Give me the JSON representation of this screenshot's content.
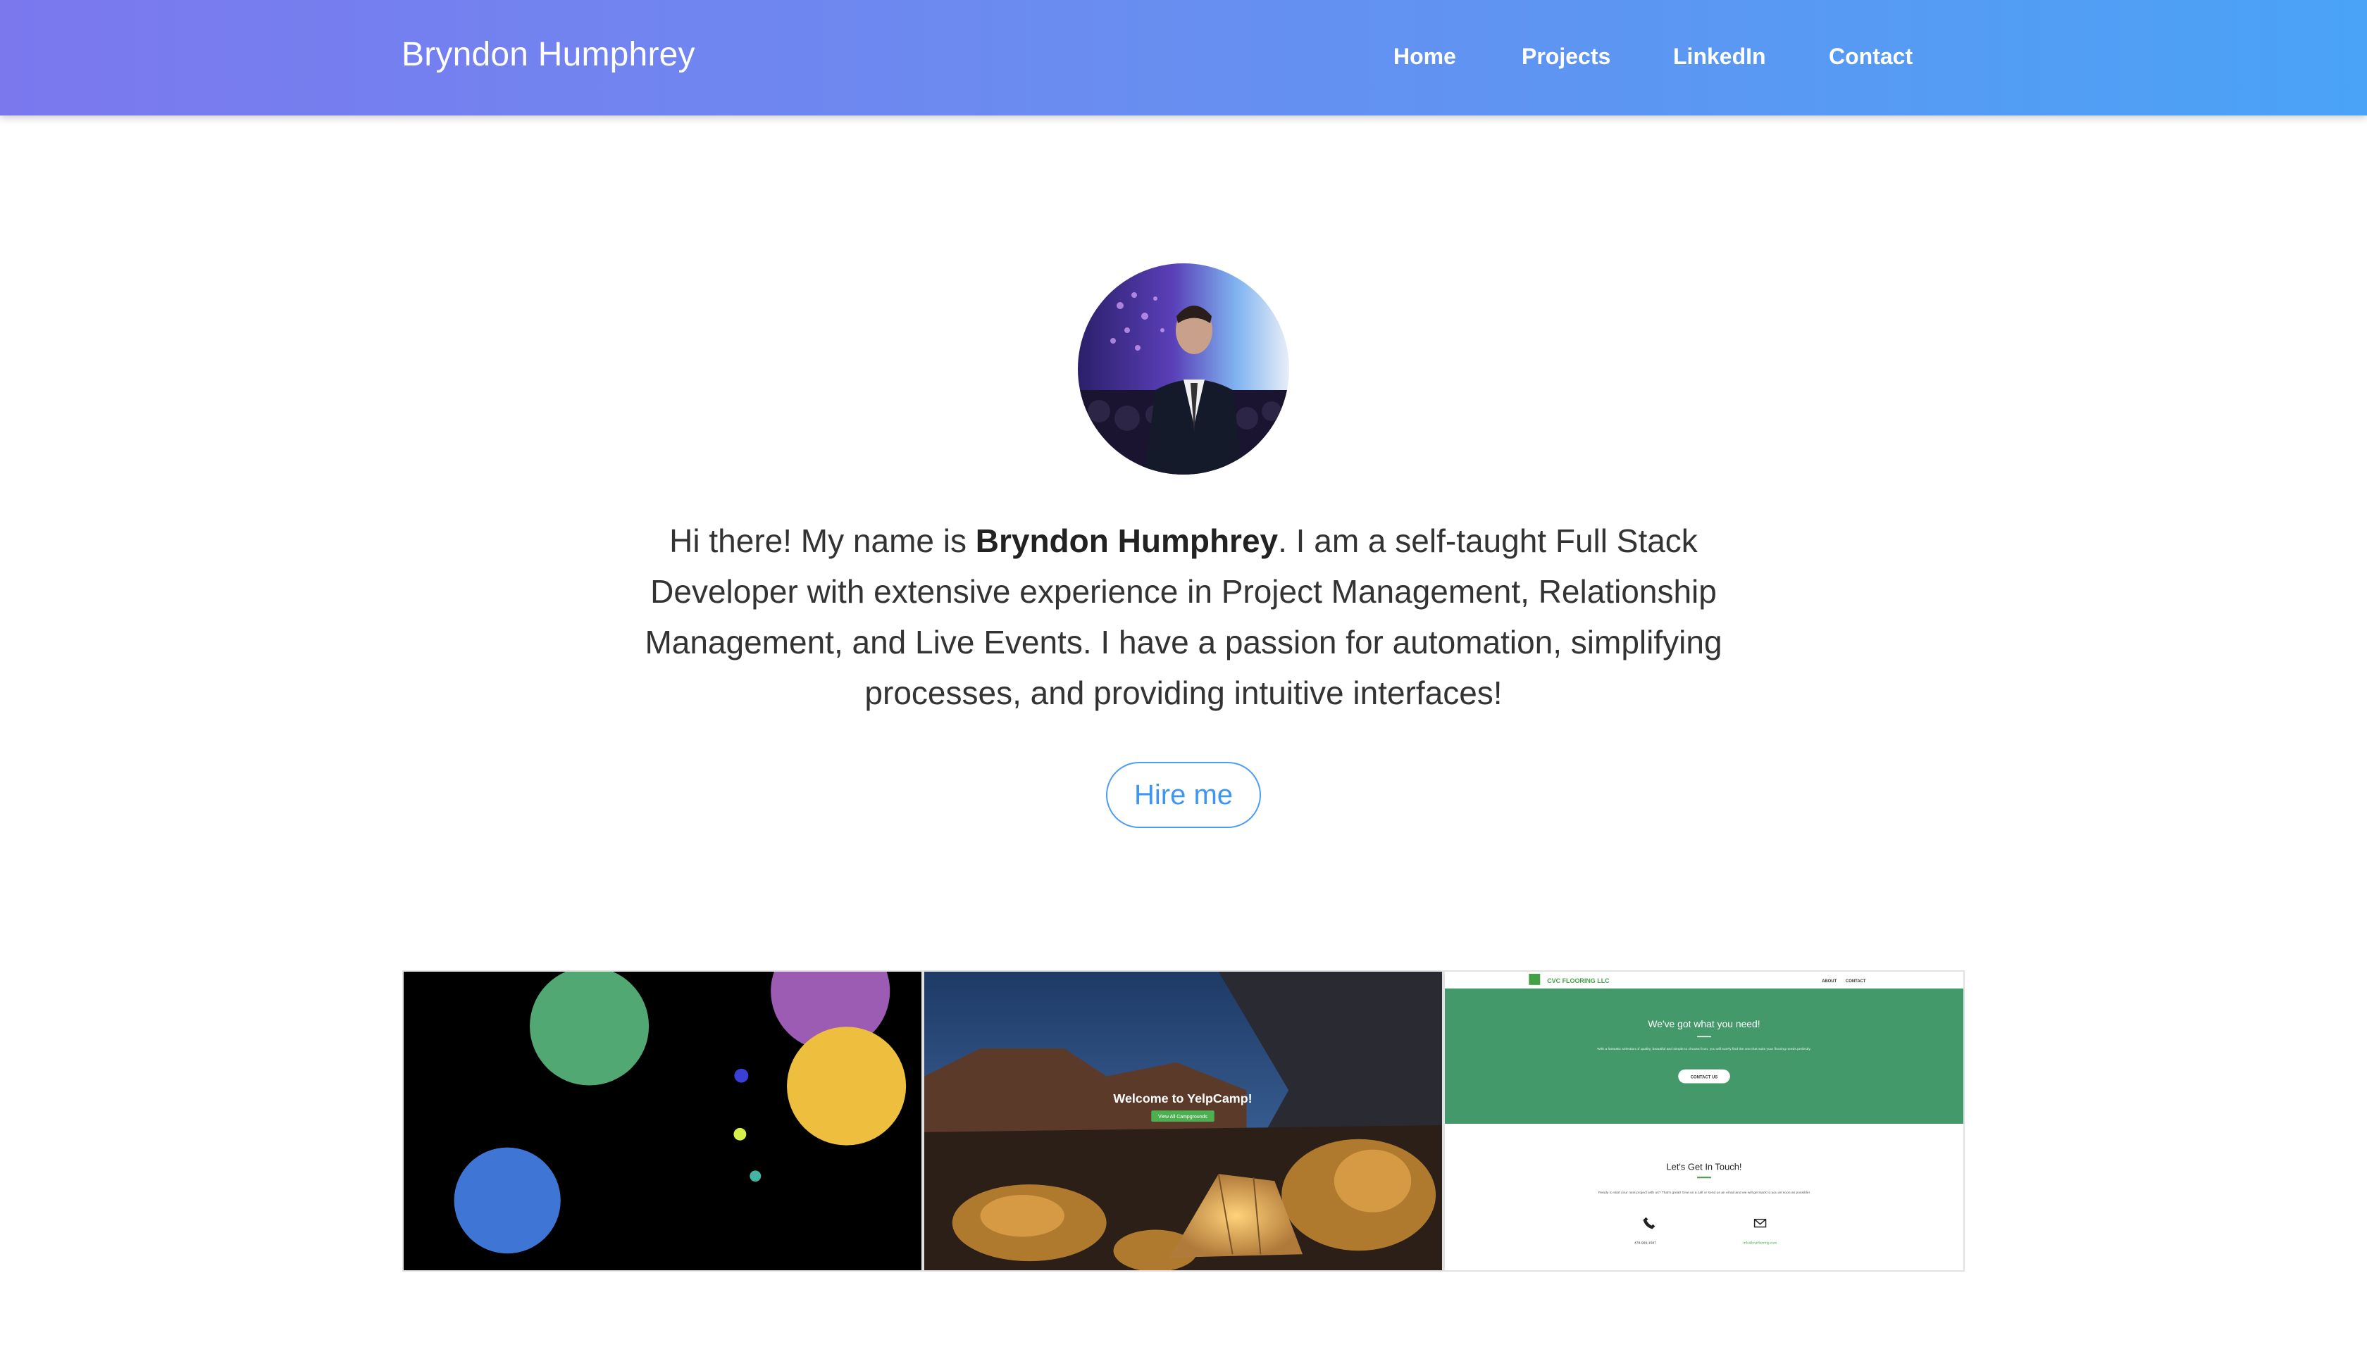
{
  "header": {
    "brand": "Bryndon Humphrey",
    "nav": [
      {
        "label": "Home"
      },
      {
        "label": "Projects"
      },
      {
        "label": "LinkedIn"
      },
      {
        "label": "Contact"
      }
    ]
  },
  "hero": {
    "intro_prefix": "Hi there! My name is ",
    "intro_name": "Bryndon Humphrey",
    "intro_suffix": ". I am a self-taught Full Stack Developer with extensive experience in Project Management, Relationship Management, and Live Events. I have a passion for automation, simplifying processes, and providing intuitive interfaces!",
    "hire_label": "Hire me"
  },
  "projects": [
    {
      "name": "bubbles-game"
    },
    {
      "name": "yelpcamp",
      "title": "Welcome to YelpCamp!",
      "button": "View All Campgrounds"
    },
    {
      "name": "cvc-flooring",
      "brand": "CVC FLOORING LLC",
      "nav": [
        "ABOUT",
        "CONTACT"
      ],
      "hero_title": "We've got what you need!",
      "hero_text": "With a fantastic selection of quality, beautiful and simple to choose from, you will surely find the one that suits your flooring needs perfectly.",
      "hero_button": "CONTACT US",
      "contact_title": "Let's Get In Touch!",
      "contact_text": "Ready to start your next project with us? That's great! Give us a call or send us an email and we will get back to you as soon as possible!",
      "phone": "478-999-1587",
      "email": "info@cvcflooring.com"
    }
  ],
  "colors": {
    "accent": "#4a9cf5",
    "nav_gradient_start": "#7b78ee",
    "nav_gradient_end": "#4aa3f6"
  }
}
